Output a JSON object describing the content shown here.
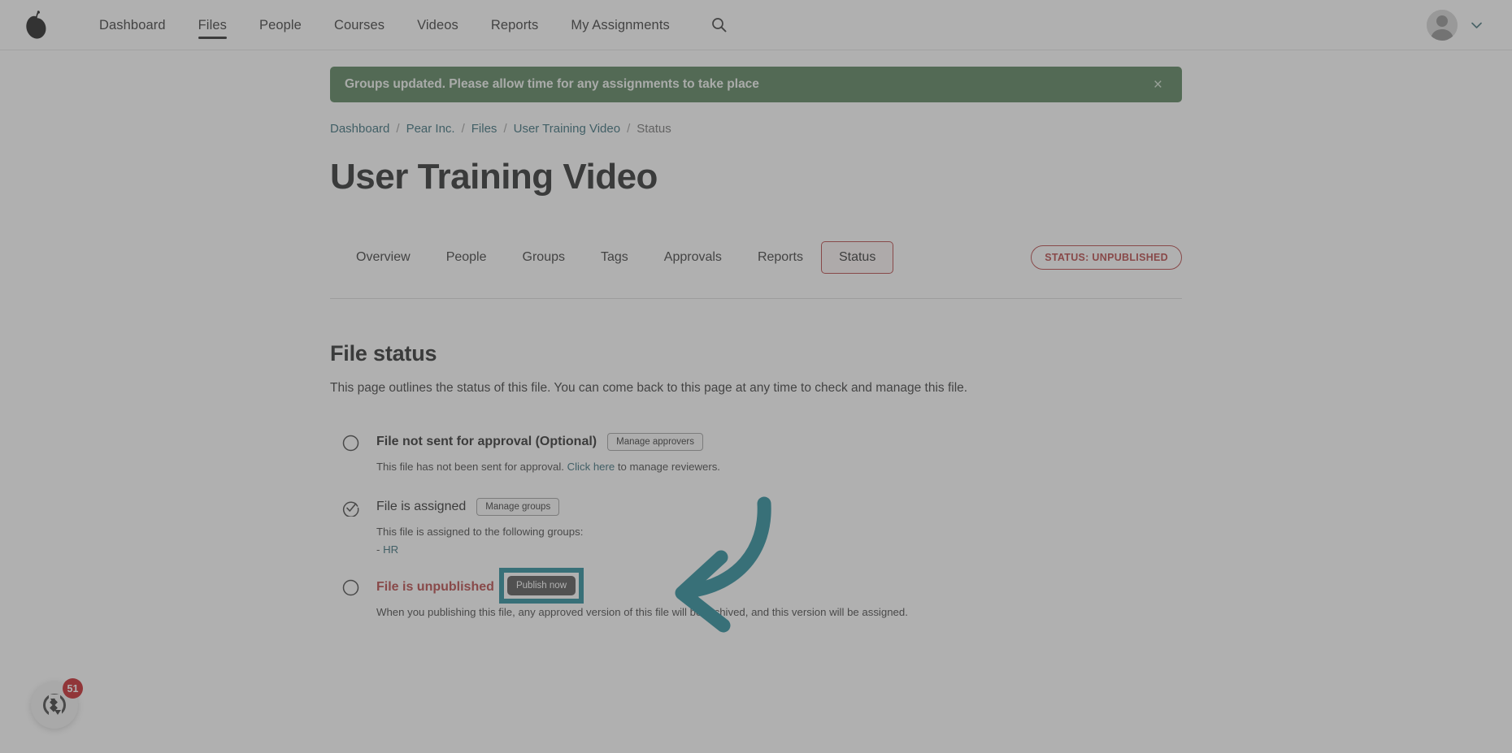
{
  "nav": {
    "logo_icon": "pear-logo-icon",
    "items": [
      {
        "label": "Dashboard",
        "active": false
      },
      {
        "label": "Files",
        "active": true
      },
      {
        "label": "People",
        "active": false
      },
      {
        "label": "Courses",
        "active": false
      },
      {
        "label": "Videos",
        "active": false
      },
      {
        "label": "Reports",
        "active": false
      },
      {
        "label": "My Assignments",
        "active": false
      }
    ],
    "search_icon": "search-icon",
    "avatar_icon": "user-avatar-icon",
    "chevron_icon": "chevron-down-icon"
  },
  "flash": {
    "message": "Groups updated. Please allow time for any assignments to take place",
    "close_label": "×",
    "background": "#4e7a51"
  },
  "breadcrumb": {
    "items": [
      {
        "label": "Dashboard",
        "current": false
      },
      {
        "label": "Pear Inc.",
        "current": false
      },
      {
        "label": "Files",
        "current": false
      },
      {
        "label": "User Training Video",
        "current": false
      },
      {
        "label": "Status",
        "current": true
      }
    ],
    "separator": "/"
  },
  "page": {
    "title": "User Training Video"
  },
  "tabs": {
    "items": [
      {
        "label": "Overview",
        "active": false
      },
      {
        "label": "People",
        "active": false
      },
      {
        "label": "Groups",
        "active": false
      },
      {
        "label": "Tags",
        "active": false
      },
      {
        "label": "Approvals",
        "active": false
      },
      {
        "label": "Reports",
        "active": false
      },
      {
        "label": "Status",
        "active": true
      }
    ],
    "status_badge": "STATUS: UNPUBLISHED",
    "status_badge_color": "#b33b3b"
  },
  "file_status": {
    "heading": "File status",
    "description": "This page outlines the status of this file. You can come back to this page at any time to check and manage this file.",
    "items": [
      {
        "icon": "circle-empty-icon",
        "label": "File not sent for approval (Optional)",
        "button": "Manage approvers",
        "sub_before": "This file has not been sent for approval. ",
        "sub_link": "Click here",
        "sub_after": " to manage reviewers."
      },
      {
        "icon": "check-circle-icon",
        "label": "File is assigned",
        "button": "Manage groups",
        "sub_before": "This file is assigned to the following groups:",
        "group_prefix": "- ",
        "group_name": "HR"
      },
      {
        "icon": "circle-empty-icon",
        "label": "File is unpublished",
        "button": "Publish now",
        "sub_before": "When you publishing this file, any approved version of this file will be archived, and this version will be assigned."
      }
    ]
  },
  "annotation": {
    "arrow_icon": "curved-arrow-left-icon",
    "arrow_color": "#1a8494",
    "highlight_border_color": "#1a8494"
  },
  "chat": {
    "icon": "chat-widget-icon",
    "badge_count": "51",
    "badge_color": "#c4161c"
  }
}
